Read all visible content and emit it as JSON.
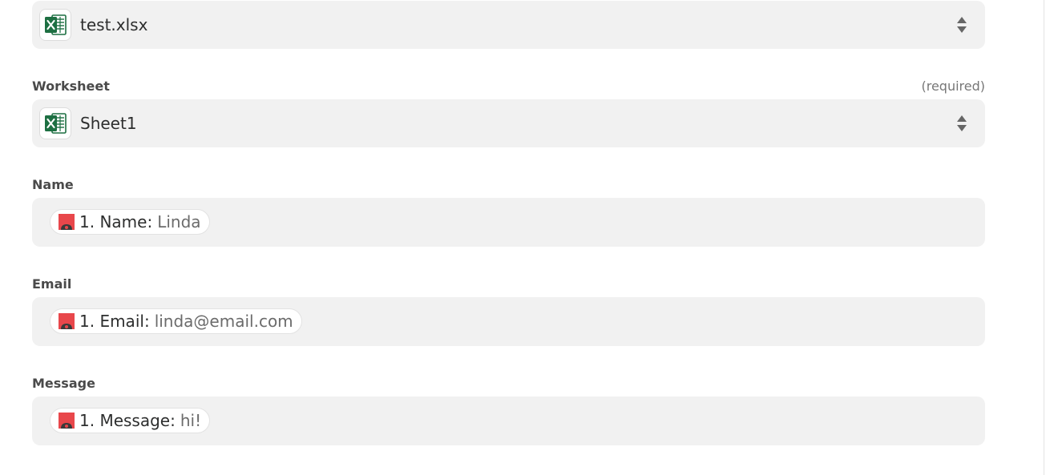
{
  "fields": {
    "spreadsheet": {
      "value": "test.xlsx",
      "icon": "excel-icon"
    },
    "worksheet": {
      "label": "Worksheet",
      "required": "(required)",
      "value": "Sheet1",
      "icon": "excel-icon"
    },
    "name": {
      "label": "Name",
      "token_key": "1. Name",
      "token_sep": ":",
      "token_value": "Linda",
      "icon": "webhook-app-icon"
    },
    "email": {
      "label": "Email",
      "token_key": "1. Email",
      "token_sep": ":",
      "token_value": "linda@email.com",
      "icon": "webhook-app-icon"
    },
    "message": {
      "label": "Message",
      "token_key": "1. Message",
      "token_sep": ":",
      "token_value": "hi!",
      "icon": "webhook-app-icon"
    }
  },
  "colors": {
    "excel_green": "#1d6f42",
    "token_icon_red": "#e8474b",
    "field_bg": "#f1f1f1"
  }
}
